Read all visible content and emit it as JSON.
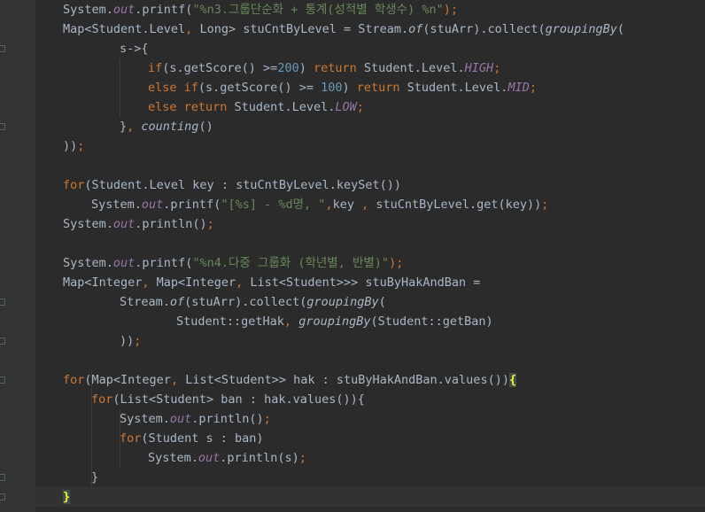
{
  "editor": {
    "colors": {
      "background": "#2b2b2b",
      "gutter": "#313335",
      "current_line": "#323232",
      "keyword": "#cc7832",
      "string": "#6a8759",
      "number": "#6897bb",
      "static_field": "#9876aa",
      "default_text": "#a9b7c6",
      "matched_brace": "#ffef28"
    },
    "lines": [
      {
        "tokens": [
          [
            "System.",
            ""
          ],
          [
            "out",
            "sf"
          ],
          [
            ".printf(",
            ""
          ],
          [
            "\"%n3.그룹단순화 + 통계(성적별 학생수) %n\"",
            "str"
          ],
          [
            ");",
            "kw"
          ]
        ]
      },
      {
        "tokens": [
          [
            "Map<Student.Level",
            ""
          ],
          [
            ", ",
            "kw"
          ],
          [
            "Long> stuCntByLevel = Stream.",
            ""
          ],
          [
            "of",
            "it"
          ],
          [
            "(stuArr).collect(",
            ""
          ],
          [
            "groupingBy",
            "it"
          ],
          [
            "(",
            ""
          ]
        ]
      },
      {
        "tokens": [
          [
            "s->{",
            ""
          ]
        ]
      },
      {
        "tokens": [
          [
            "if",
            "kw"
          ],
          [
            "(s.getScore() >=",
            ""
          ],
          [
            "200",
            "num"
          ],
          [
            ") ",
            ""
          ],
          [
            "return ",
            "kw"
          ],
          [
            "Student.Level.",
            ""
          ],
          [
            "HIGH",
            "sf"
          ],
          [
            ";",
            "kw"
          ]
        ]
      },
      {
        "tokens": [
          [
            "else if",
            "kw"
          ],
          [
            "(s.getScore() >= ",
            ""
          ],
          [
            "100",
            "num"
          ],
          [
            ") ",
            ""
          ],
          [
            "return ",
            "kw"
          ],
          [
            "Student.Level.",
            ""
          ],
          [
            "MID",
            "sf"
          ],
          [
            ";",
            "kw"
          ]
        ]
      },
      {
        "tokens": [
          [
            "else return ",
            "kw"
          ],
          [
            "Student.Level.",
            ""
          ],
          [
            "LOW",
            "sf"
          ],
          [
            ";",
            "kw"
          ]
        ]
      },
      {
        "tokens": [
          [
            "}",
            ""
          ],
          [
            ", ",
            "kw"
          ],
          [
            "counting",
            "it"
          ],
          [
            "()",
            ""
          ]
        ]
      },
      {
        "tokens": [
          [
            "))",
            ""
          ],
          [
            ";",
            "kw"
          ]
        ]
      },
      {
        "tokens": []
      },
      {
        "tokens": [
          [
            "for",
            "kw"
          ],
          [
            "(Student.Level key : stuCntByLevel.keySet())",
            ""
          ]
        ]
      },
      {
        "tokens": [
          [
            "System.",
            ""
          ],
          [
            "out",
            "sf"
          ],
          [
            ".printf(",
            ""
          ],
          [
            "\"[%s] - %d명, \"",
            "str"
          ],
          [
            ",",
            "kw"
          ],
          [
            "key ",
            ""
          ],
          [
            ", ",
            "kw"
          ],
          [
            "stuCntByLevel.get(key))",
            ""
          ],
          [
            ";",
            "kw"
          ]
        ]
      },
      {
        "tokens": [
          [
            "System.",
            ""
          ],
          [
            "out",
            "sf"
          ],
          [
            ".println()",
            ""
          ],
          [
            ";",
            "kw"
          ]
        ]
      },
      {
        "tokens": []
      },
      {
        "tokens": [
          [
            "System.",
            ""
          ],
          [
            "out",
            "sf"
          ],
          [
            ".printf(",
            ""
          ],
          [
            "\"%n4.다중 그룹화 (학년별, 반별)\"",
            "str"
          ],
          [
            ");",
            "kw"
          ]
        ]
      },
      {
        "tokens": [
          [
            "Map<Integer",
            ""
          ],
          [
            ", ",
            "kw"
          ],
          [
            "Map<Integer",
            ""
          ],
          [
            ", ",
            "kw"
          ],
          [
            "List<Student>>> stuByHakAndBan =",
            ""
          ]
        ]
      },
      {
        "tokens": [
          [
            "Stream.",
            ""
          ],
          [
            "of",
            "it"
          ],
          [
            "(stuArr).collect(",
            ""
          ],
          [
            "groupingBy",
            "it"
          ],
          [
            "(",
            ""
          ]
        ]
      },
      {
        "tokens": [
          [
            "Student::getHak",
            ""
          ],
          [
            ", ",
            "kw"
          ],
          [
            "groupingBy",
            "it"
          ],
          [
            "(Student::getBan)",
            ""
          ]
        ]
      },
      {
        "tokens": [
          [
            "))",
            ""
          ],
          [
            ";",
            "kw"
          ]
        ]
      },
      {
        "tokens": []
      },
      {
        "tokens": [
          [
            "for",
            "kw"
          ],
          [
            "(Map<Integer",
            ""
          ],
          [
            ", ",
            "kw"
          ],
          [
            "List<Student>> hak : stuByHakAndBan.values())",
            ""
          ],
          [
            "{",
            "hl"
          ]
        ]
      },
      {
        "tokens": [
          [
            "for",
            "kw"
          ],
          [
            "(List<Student> ban : hak.values()){",
            ""
          ]
        ]
      },
      {
        "tokens": [
          [
            "System.",
            ""
          ],
          [
            "out",
            "sf"
          ],
          [
            ".println()",
            ""
          ],
          [
            ";",
            "kw"
          ]
        ]
      },
      {
        "tokens": [
          [
            "for",
            "kw"
          ],
          [
            "(Student s : ban)",
            ""
          ]
        ]
      },
      {
        "tokens": [
          [
            "System.",
            ""
          ],
          [
            "out",
            "sf"
          ],
          [
            ".println(s)",
            ""
          ],
          [
            ";",
            "kw"
          ]
        ]
      },
      {
        "tokens": [
          [
            "}",
            ""
          ]
        ]
      },
      {
        "tokens": [
          [
            "}",
            "hl"
          ]
        ]
      }
    ]
  }
}
